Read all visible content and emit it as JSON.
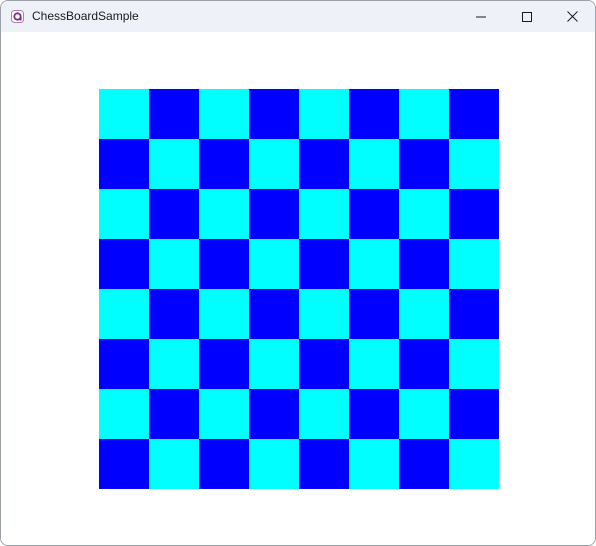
{
  "window": {
    "title": "ChessBoardSample",
    "app_icon": "app-logo-icon",
    "controls": {
      "minimize_icon": "minimize-icon",
      "maximize_icon": "maximize-icon",
      "close_icon": "close-icon"
    }
  },
  "board": {
    "rows": 8,
    "cols": 8,
    "light_color": "#00ffff",
    "dark_color": "#0000ff",
    "top_left": "light"
  }
}
